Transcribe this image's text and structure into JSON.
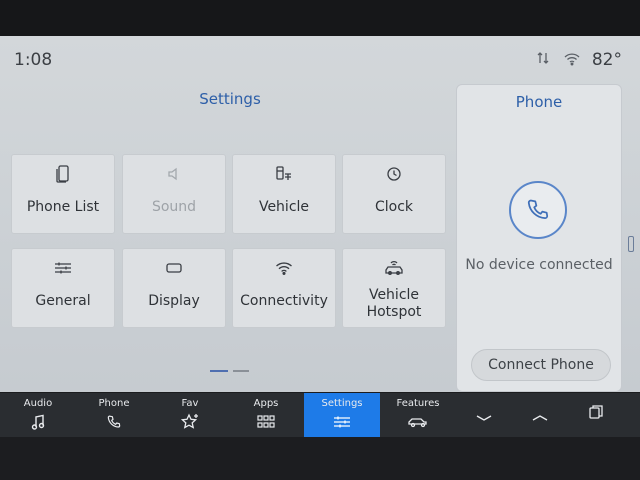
{
  "status": {
    "time": "1:08",
    "temperature": "82°"
  },
  "settings": {
    "title": "Settings",
    "tiles": [
      {
        "label": "Phone List",
        "icon": "phone-list-icon",
        "enabled": true
      },
      {
        "label": "Sound",
        "icon": "speaker-icon",
        "enabled": false
      },
      {
        "label": "Vehicle",
        "icon": "vehicle-settings-icon",
        "enabled": true
      },
      {
        "label": "Clock",
        "icon": "clock-icon",
        "enabled": true
      },
      {
        "label": "General",
        "icon": "sliders-icon",
        "enabled": true
      },
      {
        "label": "Display",
        "icon": "display-icon",
        "enabled": true
      },
      {
        "label": "Connectivity",
        "icon": "wifi-icon",
        "enabled": true
      },
      {
        "label": "Vehicle Hotspot",
        "icon": "vehicle-hotspot-icon",
        "enabled": true
      }
    ],
    "page_count": 2,
    "current_page": 1
  },
  "phone_panel": {
    "title": "Phone",
    "status": "No device connected",
    "connect_label": "Connect Phone"
  },
  "nav": {
    "items": [
      {
        "label": "Audio",
        "icon": "music-note-icon"
      },
      {
        "label": "Phone",
        "icon": "phone-icon"
      },
      {
        "label": "Fav",
        "icon": "star-plus-icon"
      },
      {
        "label": "Apps",
        "icon": "apps-grid-icon"
      },
      {
        "label": "Settings",
        "icon": "sliders-icon",
        "active": true
      },
      {
        "label": "Features",
        "icon": "car-icon"
      },
      {
        "label": "",
        "icon": "chevron-down-icon"
      },
      {
        "label": "",
        "icon": "chevron-up-icon"
      },
      {
        "label": "",
        "icon": "multi-window-icon"
      }
    ]
  },
  "colors": {
    "accent": "#2d5fa8",
    "nav_active": "#1e7be8",
    "nav_bg": "#2a2d31"
  }
}
